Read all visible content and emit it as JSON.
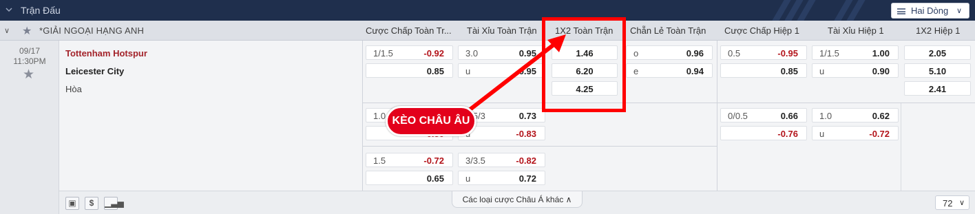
{
  "topbar": {
    "title": "Trận Đấu",
    "select_label": "Hai Dòng"
  },
  "header": {
    "league": "*GIẢI NGOẠI HẠNG ANH",
    "cols": [
      "Cược Chấp Toàn Tr...",
      "Tài Xỉu Toàn Trận",
      "1X2 Toàn Trận",
      "Chẵn Lẻ Toàn Trận",
      "Cược Chấp Hiệp 1",
      "Tài Xỉu Hiệp 1",
      "1X2 Hiệp 1"
    ]
  },
  "match": {
    "date": "09/17",
    "time": "11:30PM",
    "home": "Tottenham Hotspur",
    "away": "Leicester City",
    "draw": "Hòa"
  },
  "odds": {
    "r1": {
      "ah_line": "1/1.5",
      "ah_home": "-0.92",
      "ah_away": "0.85",
      "ou_line": "3.0",
      "ou_over": "0.95",
      "ou_u": "u",
      "ou_under": "0.95",
      "x12_home": "1.46",
      "x12_away": "6.20",
      "x12_draw": "4.25",
      "oe_o": "o",
      "oe_odd": "0.96",
      "oe_e": "e",
      "oe_even": "0.94",
      "h1ah_line": "0.5",
      "h1ah_home": "-0.95",
      "h1ah_away": "0.85",
      "h1ou_line": "1/1.5",
      "h1ou_over": "1.00",
      "h1ou_u": "u",
      "h1ou_under": "0.90",
      "h1x12_home": "2.05",
      "h1x12_away": "5.10",
      "h1x12_draw": "2.41"
    },
    "r2": {
      "ah_line": "1.0",
      "ah_away": "-0.80",
      "ou_line": "3.5/3",
      "ou_over": "0.73",
      "ou_u": "u",
      "ou_under": "-0.83",
      "h1ah_line": "0/0.5",
      "h1ah_home": "0.66",
      "h1ah_away": "-0.76",
      "h1ou_line": "1.0",
      "h1ou_over": "0.62",
      "h1ou_u": "u",
      "h1ou_under": "-0.72"
    },
    "r3": {
      "ah_line": "1.5",
      "ah_home": "-0.72",
      "ah_away": "0.65",
      "ou_line": "3/3.5",
      "ou_over": "-0.82",
      "ou_u": "u",
      "ou_under": "0.72"
    }
  },
  "footer": {
    "more_label": "Các loại cược Châu Á khác",
    "count": "72"
  },
  "annotation": {
    "label": "KÈO CHÂU ÂU"
  },
  "colors": {
    "accent_red": "#e3001b",
    "header_bg": "#1f2f4d",
    "negative": "#b3131a"
  }
}
